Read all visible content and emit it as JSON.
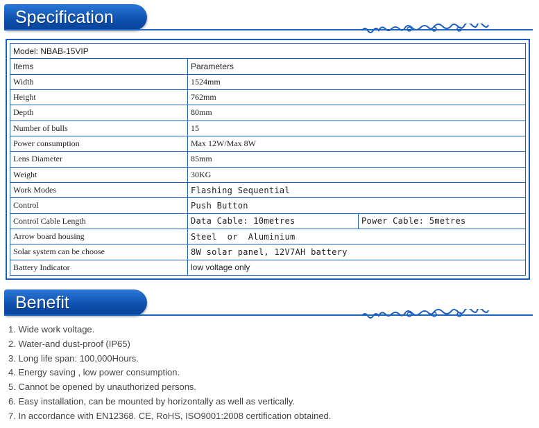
{
  "spec_section": {
    "title": "Specification",
    "model": "Model: NBAB-15VIP",
    "rows": [
      {
        "item": "Items",
        "param": "Parameters",
        "param2": ""
      },
      {
        "item": "Width",
        "param": "1524mm",
        "param2": ""
      },
      {
        "item": "Height",
        "param": "762mm",
        "param2": ""
      },
      {
        "item": "Depth",
        "param": "80mm",
        "param2": ""
      },
      {
        "item": "Number of bulls",
        "param": "15",
        "param2": ""
      },
      {
        "item": "Power consumption",
        "param": "Max 12W/Max 8W",
        "param2": ""
      },
      {
        "item": "Lens Diameter",
        "param": "85mm",
        "param2": ""
      },
      {
        "item": "Weight",
        "param": "30KG",
        "param2": ""
      },
      {
        "item": "Work Modes",
        "param": "Flashing Sequential",
        "param2": ""
      },
      {
        "item": "Control",
        "param": "Push Button",
        "param2": ""
      },
      {
        "item": "Control Cable Length",
        "param": "Data Cable: 10metres",
        "param2": "Power Cable: 5metres"
      },
      {
        "item": "Arrow board housing",
        "param": "Steel  or  Aluminium",
        "param2": ""
      },
      {
        "item": "Solar system can be choose",
        "param": "8W solar panel, 12V7AH battery",
        "param2": ""
      },
      {
        "item": "Battery Indicator",
        "param": "low voltage only",
        "param2": ""
      }
    ]
  },
  "benefit_section": {
    "title": "Benefit",
    "items": [
      "1. Wide work voltage.",
      "2. Water-and dust-proof (IP65)",
      "3. Long life span: 100,000Hours.",
      "4. Energy saving , low power consumption.",
      "5. Cannot be opened by unauthorized persons.",
      "6. Easy installation, can be mounted by horizontally as well as vertically.",
      "7. In accordance with EN12368. CE, RoHS, ISO9001:2008 certification obtained."
    ]
  },
  "colors": {
    "accent": "#1a5fc0",
    "tab": "#0d4fae"
  },
  "icons": {
    "ornament": "scroll-ornament-icon"
  }
}
